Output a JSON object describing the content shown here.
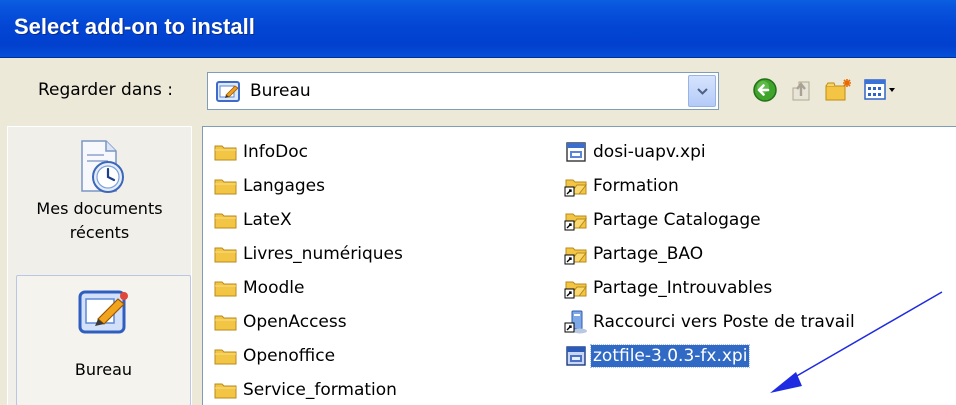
{
  "window": {
    "title": "Select add-on to install"
  },
  "look_in": {
    "label": "Regarder dans :",
    "current": "Bureau"
  },
  "toolbar": {
    "icons": [
      "back-icon",
      "up-folder-icon",
      "new-folder-icon",
      "view-menu-icon"
    ]
  },
  "places": [
    {
      "label_line1": "Mes documents",
      "label_line2": "récents",
      "icon": "recent-documents-icon"
    },
    {
      "label_line1": "Bureau",
      "icon": "desktop-icon",
      "selected": true
    }
  ],
  "files": {
    "column1": [
      {
        "name": "InfoDoc",
        "type": "folder"
      },
      {
        "name": "Langages",
        "type": "folder"
      },
      {
        "name": "LateX",
        "type": "folder"
      },
      {
        "name": "Livres_numériques",
        "type": "folder"
      },
      {
        "name": "Moodle",
        "type": "folder"
      },
      {
        "name": "OpenAccess",
        "type": "folder"
      },
      {
        "name": "Openoffice",
        "type": "folder"
      },
      {
        "name": "Service_formation",
        "type": "folder"
      }
    ],
    "column2": [
      {
        "name": "dosi-uapv.xpi",
        "type": "xpi-file"
      },
      {
        "name": "Formation",
        "type": "folder-shortcut"
      },
      {
        "name": "Partage Catalogage",
        "type": "folder-shortcut"
      },
      {
        "name": "Partage_BAO",
        "type": "folder-shortcut"
      },
      {
        "name": "Partage_Introuvables",
        "type": "folder-shortcut"
      },
      {
        "name": "Raccourci vers Poste de travail",
        "type": "computer-shortcut"
      },
      {
        "name": "zotfile-3.0.3-fx.xpi",
        "type": "xpi-file",
        "selected": true
      }
    ]
  },
  "colors": {
    "titlebar": "#0346D4",
    "selection": "#316AC5",
    "annotation_arrow": "#1E2BE0"
  }
}
